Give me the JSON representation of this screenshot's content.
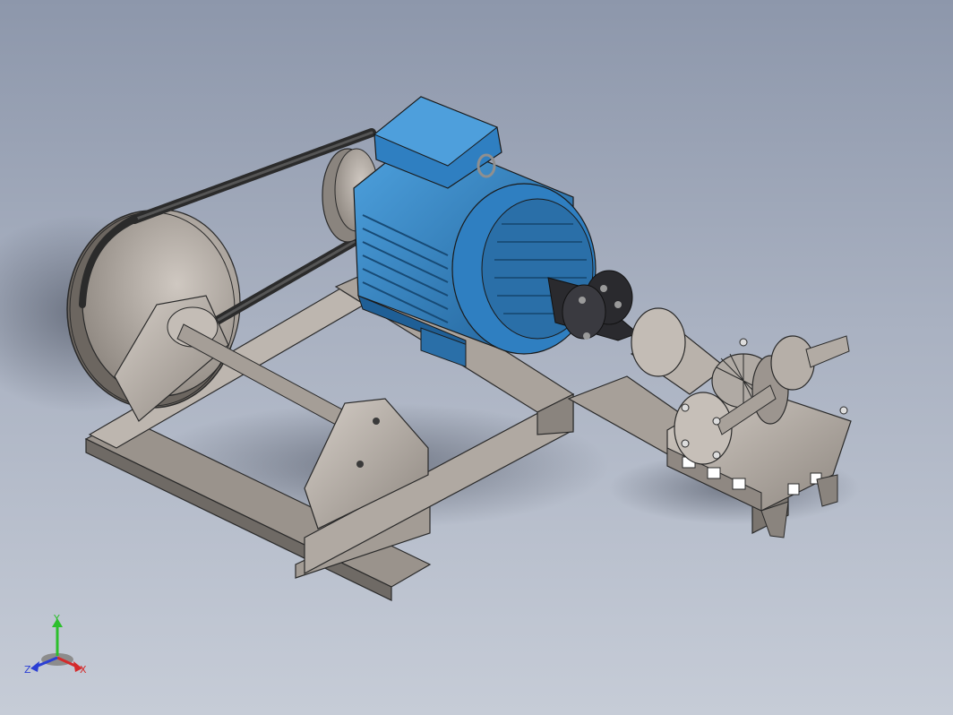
{
  "viewport": {
    "background_top": "#8d97ab",
    "background_bottom": "#c6ccd7"
  },
  "model": {
    "components": [
      "base-frame",
      "drive-pulley",
      "v-belt",
      "motor-pulley",
      "electric-motor",
      "shaft-coupling",
      "bevel-gearbox",
      "output-shaft",
      "pillow-block-bearing"
    ],
    "colors": {
      "motor": "#2f7fc1",
      "steel": "#b3aba3",
      "belt": "#2b2b2b",
      "coupling": "#2a2a2e"
    }
  },
  "triad": {
    "y_label": "Y",
    "x_label": "X",
    "z_label": "Z",
    "y_color": "#2cbf2c",
    "x_color": "#d42b2b",
    "z_color": "#2b3fd4"
  }
}
